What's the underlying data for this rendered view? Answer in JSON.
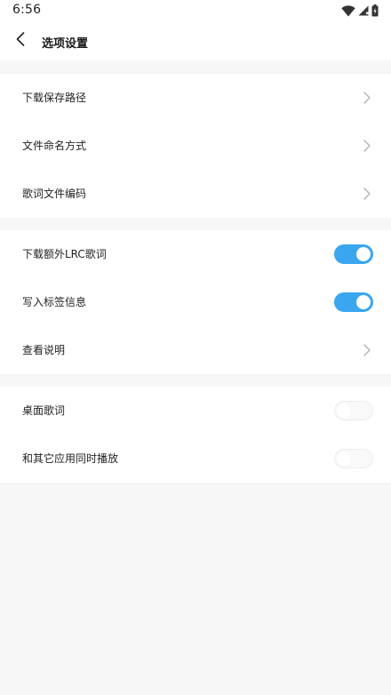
{
  "status_bar": {
    "time": "6:56",
    "icons": [
      "wifi-icon",
      "signal-icon",
      "battery-icon"
    ]
  },
  "header": {
    "back_icon": "chevron-left-icon",
    "title": "选项设置"
  },
  "groups": [
    {
      "items": [
        {
          "label": "下载保存路径",
          "control": "chevron"
        },
        {
          "label": "文件命名方式",
          "control": "chevron"
        },
        {
          "label": "歌词文件编码",
          "control": "chevron"
        }
      ]
    },
    {
      "items": [
        {
          "label": "下载额外LRC歌词",
          "control": "toggle",
          "on": true
        },
        {
          "label": "写入标签信息",
          "control": "toggle",
          "on": true
        },
        {
          "label": "查看说明",
          "control": "chevron"
        }
      ]
    },
    {
      "items": [
        {
          "label": "桌面歌词",
          "control": "toggle",
          "on": false
        },
        {
          "label": "和其它应用同时播放",
          "control": "toggle",
          "on": false
        }
      ]
    }
  ],
  "colors": {
    "toggle_on": "#3aa6ef",
    "background": "#f7f7f7",
    "card": "#ffffff",
    "chevron": "#b5b5b5"
  }
}
